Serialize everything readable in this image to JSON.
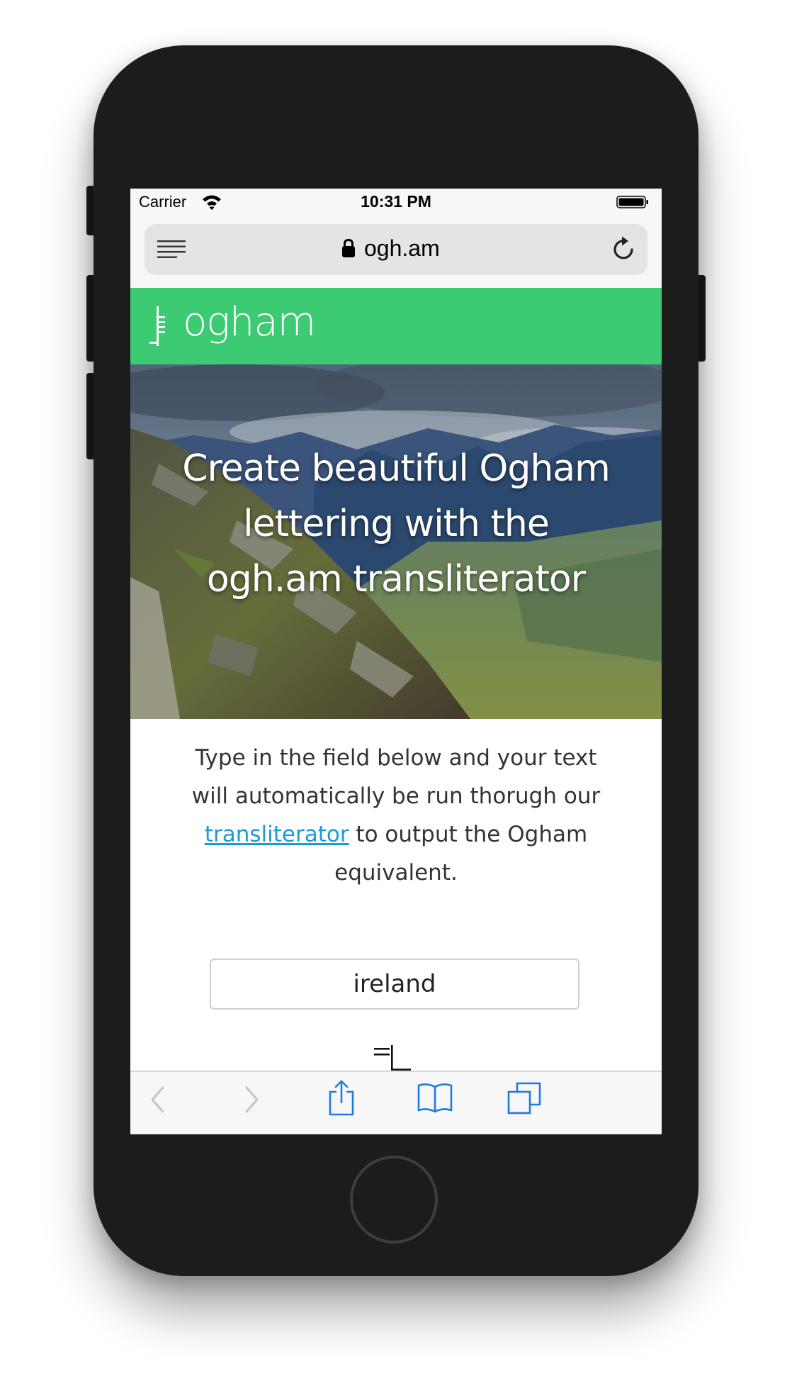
{
  "status_bar": {
    "carrier": "Carrier",
    "time": "10:31 PM"
  },
  "browser": {
    "url": "ogh.am"
  },
  "site": {
    "logo_text": "ogham",
    "hero_title": "Create beautiful Ogham lettering with the ogh.am transliterator",
    "intro": {
      "before_link": "Type in the field below and your text will automatically be run thorugh our ",
      "link_text": "transliterator",
      "after_link": " to output the Ogham equivalent."
    },
    "input_value": "ireland"
  },
  "colors": {
    "brand_green": "#3cca73",
    "link_blue": "#1a9bd7",
    "ios_blue": "#1f7ae0"
  },
  "icons": {
    "reader": "reader-icon",
    "lock": "lock-icon",
    "reload": "reload-icon",
    "back": "chevron-left-icon",
    "forward": "chevron-right-icon",
    "share": "share-icon",
    "bookmarks": "book-icon",
    "tabs": "tabs-icon"
  }
}
